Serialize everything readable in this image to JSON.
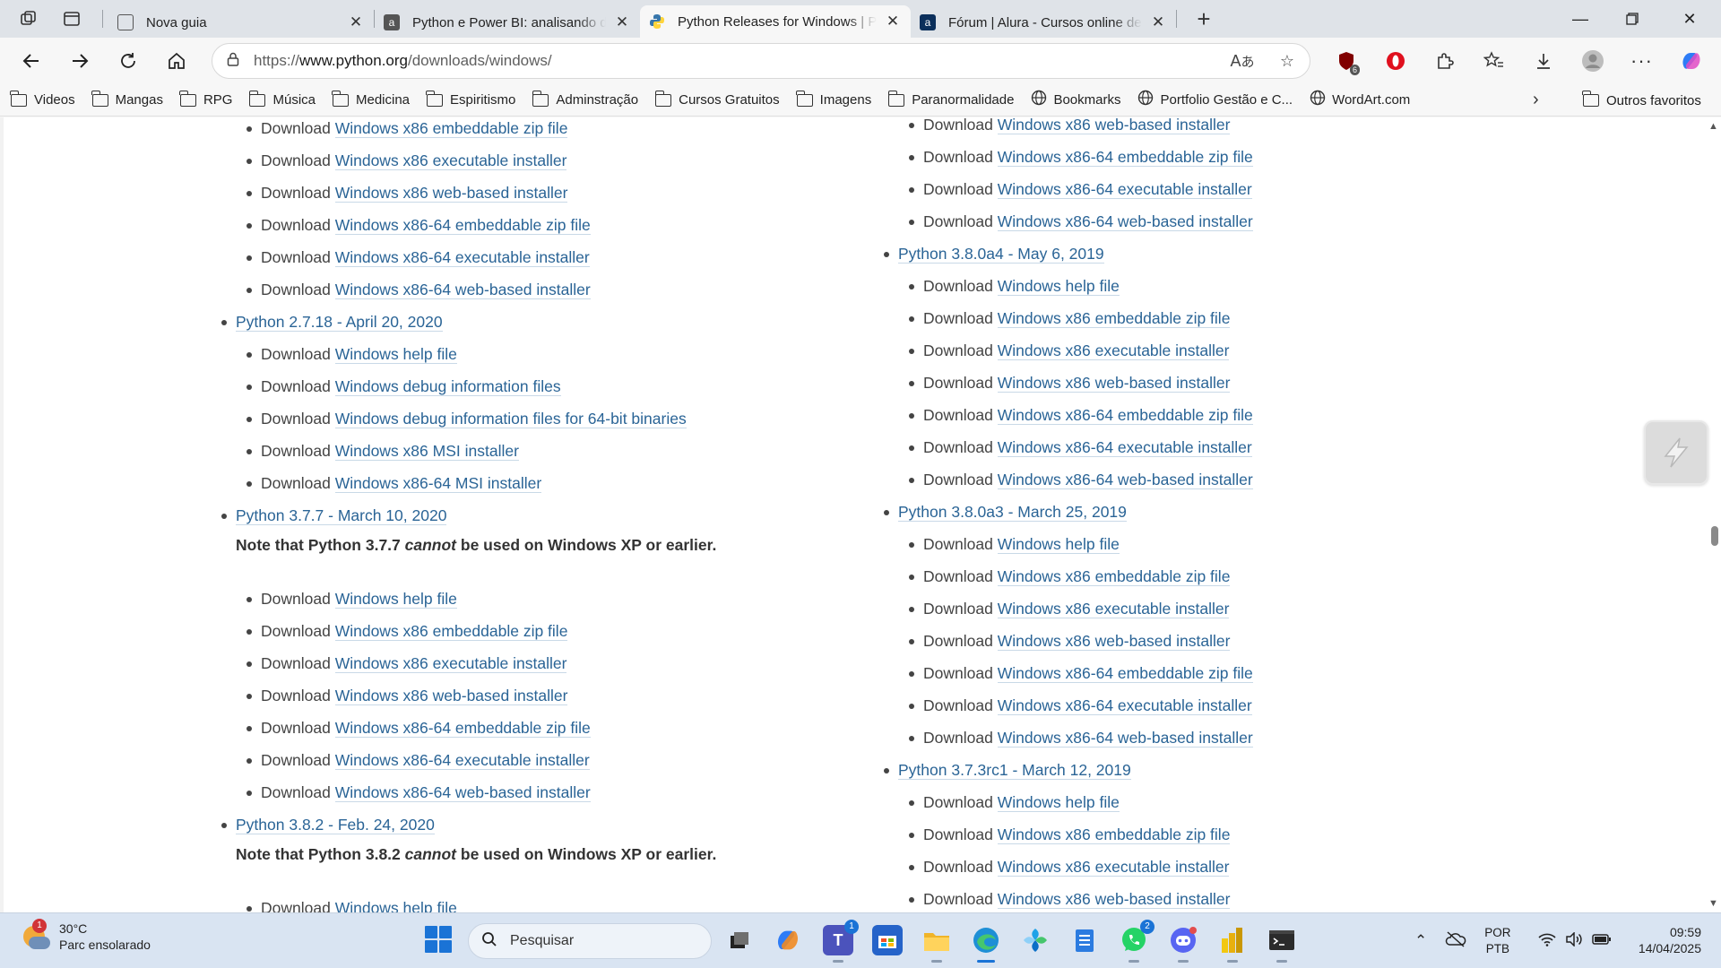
{
  "tabs": [
    {
      "title": "Nova guia",
      "icon": "new-tab-icon",
      "active": false
    },
    {
      "title": "Python e Power BI: analisando dados",
      "icon": "alura-icon",
      "active": false
    },
    {
      "title": "Python Releases for Windows | Python.org",
      "icon": "python-icon",
      "active": true
    },
    {
      "title": "Fórum | Alura - Cursos online de tecnologia",
      "icon": "alura-icon",
      "active": false
    }
  ],
  "address": {
    "prefix": "https://",
    "host": "www.python.org",
    "path": "/downloads/windows/"
  },
  "bookmarks": [
    {
      "label": "Videos",
      "type": "folder"
    },
    {
      "label": "Mangas",
      "type": "folder"
    },
    {
      "label": "RPG",
      "type": "folder"
    },
    {
      "label": "Música",
      "type": "folder"
    },
    {
      "label": "Medicina",
      "type": "folder"
    },
    {
      "label": "Espiritismo",
      "type": "folder"
    },
    {
      "label": "Adminstração",
      "type": "folder"
    },
    {
      "label": "Cursos Gratuitos",
      "type": "folder"
    },
    {
      "label": "Imagens",
      "type": "folder"
    },
    {
      "label": "Paranormalidade",
      "type": "folder"
    },
    {
      "label": "Bookmarks",
      "type": "globe"
    },
    {
      "label": "Portfolio Gestão e C...",
      "type": "globe"
    },
    {
      "label": "WordArt.com",
      "type": "globe"
    }
  ],
  "bookmarks_other": "Outros favoritos",
  "extension_badge": "6",
  "download_word": "Download",
  "left_column": [
    {
      "kind": "link",
      "text": "Windows x86 embeddable zip file"
    },
    {
      "kind": "link",
      "text": "Windows x86 executable installer"
    },
    {
      "kind": "link",
      "text": "Windows x86 web-based installer"
    },
    {
      "kind": "link",
      "text": "Windows x86-64 embeddable zip file"
    },
    {
      "kind": "link",
      "text": "Windows x86-64 executable installer"
    },
    {
      "kind": "link",
      "text": "Windows x86-64 web-based installer"
    },
    {
      "kind": "release",
      "text": "Python 2.7.18 - April 20, 2020"
    },
    {
      "kind": "link",
      "text": "Windows help file"
    },
    {
      "kind": "link",
      "text": "Windows debug information files"
    },
    {
      "kind": "link",
      "text": "Windows debug information files for 64-bit binaries"
    },
    {
      "kind": "link",
      "text": "Windows x86 MSI installer"
    },
    {
      "kind": "link",
      "text": "Windows x86-64 MSI installer"
    },
    {
      "kind": "release",
      "text": "Python 3.7.7 - March 10, 2020"
    },
    {
      "kind": "note",
      "before": "Note that Python 3.7.7 ",
      "em": "cannot",
      "after": " be used on Windows XP or earlier."
    },
    {
      "kind": "link",
      "text": "Windows help file"
    },
    {
      "kind": "link",
      "text": "Windows x86 embeddable zip file"
    },
    {
      "kind": "link",
      "text": "Windows x86 executable installer"
    },
    {
      "kind": "link",
      "text": "Windows x86 web-based installer"
    },
    {
      "kind": "link",
      "text": "Windows x86-64 embeddable zip file"
    },
    {
      "kind": "link",
      "text": "Windows x86-64 executable installer"
    },
    {
      "kind": "link",
      "text": "Windows x86-64 web-based installer"
    },
    {
      "kind": "release",
      "text": "Python 3.8.2 - Feb. 24, 2020"
    },
    {
      "kind": "note",
      "before": "Note that Python 3.8.2 ",
      "em": "cannot",
      "after": " be used on Windows XP or earlier."
    },
    {
      "kind": "link",
      "text": "Windows help file"
    }
  ],
  "right_column": [
    {
      "kind": "link",
      "text": "Windows x86 web-based installer"
    },
    {
      "kind": "link",
      "text": "Windows x86-64 embeddable zip file"
    },
    {
      "kind": "link",
      "text": "Windows x86-64 executable installer"
    },
    {
      "kind": "link",
      "text": "Windows x86-64 web-based installer"
    },
    {
      "kind": "release",
      "text": "Python 3.8.0a4 - May 6, 2019"
    },
    {
      "kind": "link",
      "text": "Windows help file"
    },
    {
      "kind": "link",
      "text": "Windows x86 embeddable zip file"
    },
    {
      "kind": "link",
      "text": "Windows x86 executable installer"
    },
    {
      "kind": "link",
      "text": "Windows x86 web-based installer"
    },
    {
      "kind": "link",
      "text": "Windows x86-64 embeddable zip file"
    },
    {
      "kind": "link",
      "text": "Windows x86-64 executable installer"
    },
    {
      "kind": "link",
      "text": "Windows x86-64 web-based installer"
    },
    {
      "kind": "release",
      "text": "Python 3.8.0a3 - March 25, 2019"
    },
    {
      "kind": "link",
      "text": "Windows help file"
    },
    {
      "kind": "link",
      "text": "Windows x86 embeddable zip file"
    },
    {
      "kind": "link",
      "text": "Windows x86 executable installer"
    },
    {
      "kind": "link",
      "text": "Windows x86 web-based installer"
    },
    {
      "kind": "link",
      "text": "Windows x86-64 embeddable zip file"
    },
    {
      "kind": "link",
      "text": "Windows x86-64 executable installer"
    },
    {
      "kind": "link",
      "text": "Windows x86-64 web-based installer"
    },
    {
      "kind": "release",
      "text": "Python 3.7.3rc1 - March 12, 2019"
    },
    {
      "kind": "link",
      "text": "Windows help file"
    },
    {
      "kind": "link",
      "text": "Windows x86 embeddable zip file"
    },
    {
      "kind": "link",
      "text": "Windows x86 executable installer"
    },
    {
      "kind": "link",
      "text": "Windows x86 web-based installer"
    }
  ],
  "weather": {
    "temp": "30°C",
    "desc": "Parc ensolarado",
    "badge": "1"
  },
  "taskbar_search": "Pesquisar",
  "taskbar_apps": [
    {
      "name": "task-view-icon",
      "badge": ""
    },
    {
      "name": "copilot-icon",
      "badge": ""
    },
    {
      "name": "teams-icon",
      "badge": "1"
    },
    {
      "name": "store-icon",
      "badge": ""
    },
    {
      "name": "file-explorer-icon",
      "badge": ""
    },
    {
      "name": "edge-icon",
      "badge": ""
    },
    {
      "name": "photos-icon",
      "badge": ""
    },
    {
      "name": "notepad-icon",
      "badge": ""
    },
    {
      "name": "whatsapp-icon",
      "badge": "2"
    },
    {
      "name": "discord-icon",
      "badge": ""
    },
    {
      "name": "power-bi-icon",
      "badge": ""
    },
    {
      "name": "terminal-icon",
      "badge": ""
    }
  ],
  "tray": {
    "lang1": "POR",
    "lang2": "PTB"
  },
  "clock": {
    "time": "09:59",
    "date": "14/04/2025"
  },
  "colors": {
    "link": "#2a6496",
    "accent": "#1a73d6"
  }
}
